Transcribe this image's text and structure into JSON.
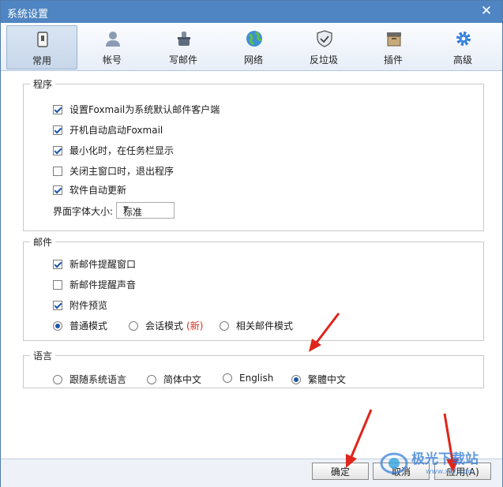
{
  "window": {
    "title": "系统设置",
    "close_icon": "close-icon"
  },
  "toolbar": {
    "items": [
      {
        "label": "常用",
        "icon": "general-settings-icon"
      },
      {
        "label": "帐号",
        "icon": "user-icon"
      },
      {
        "label": "写邮件",
        "icon": "compose-icon"
      },
      {
        "label": "网络",
        "icon": "globe-icon"
      },
      {
        "label": "反垃圾",
        "icon": "shield-icon"
      },
      {
        "label": "插件",
        "icon": "plugin-box-icon"
      },
      {
        "label": "高级",
        "icon": "gear-icon"
      }
    ],
    "active_index": 0
  },
  "program": {
    "legend": "程序",
    "options": [
      {
        "label": "设置Foxmail为系统默认邮件客户端",
        "checked": true
      },
      {
        "label": "开机自动启动Foxmail",
        "checked": true
      },
      {
        "label": "最小化时，在任务栏显示",
        "checked": true
      },
      {
        "label": "关闭主窗口时，退出程序",
        "checked": false
      },
      {
        "label": "软件自动更新",
        "checked": true
      }
    ],
    "font_size_label": "界面字体大小:",
    "font_size_value": "标准"
  },
  "mail": {
    "legend": "邮件",
    "options": [
      {
        "label": "新邮件提醒窗口",
        "checked": true
      },
      {
        "label": "新邮件提醒声音",
        "checked": false
      },
      {
        "label": "附件预览",
        "checked": true
      }
    ],
    "modes": [
      {
        "label": "普通模式",
        "selected": true
      },
      {
        "label": "会话模式",
        "selected": false,
        "badge": "(新)"
      },
      {
        "label": "相关邮件模式",
        "selected": false
      }
    ],
    "badge_color": "#d7301f"
  },
  "language": {
    "legend": "语言",
    "options": [
      {
        "label": "跟随系统语言",
        "selected": false
      },
      {
        "label": "简体中文",
        "selected": false
      },
      {
        "label": "English",
        "selected": false
      },
      {
        "label": "繁體中文",
        "selected": true
      }
    ]
  },
  "footer": {
    "ok": "确定",
    "cancel": "取消",
    "apply": "应用(A)"
  },
  "watermark": {
    "text": "极光下载站",
    "url": "www.xz7.com"
  },
  "colors": {
    "titlebar": "#4f85c2",
    "accent": "#1c56a6",
    "arrow": "#e0251b"
  }
}
